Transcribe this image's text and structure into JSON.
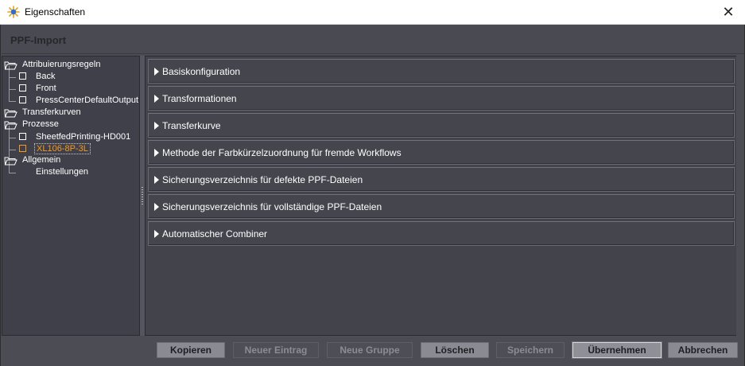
{
  "window": {
    "title": "Eigenschaften",
    "close_glyph": "✕"
  },
  "header": {
    "title": "PPF-Import"
  },
  "tree": {
    "groups": [
      {
        "label": "Attribuierungsregeln",
        "children": [
          "Back",
          "Front",
          "PressCenterDefaultOutput"
        ]
      },
      {
        "label": "Transferkurven",
        "children": []
      },
      {
        "label": "Prozesse",
        "children": [
          "SheetfedPrinting-HD001",
          "XL106-8P-3L"
        ]
      },
      {
        "label": "Allgemein",
        "children": [
          "Einstellungen"
        ]
      }
    ],
    "selected": "XL106-8P-3L",
    "selected_color": "#f59a1f"
  },
  "sections": [
    "Basiskonfiguration",
    "Transformationen",
    "Transferkurve",
    "Methode der Farbkürzelzuordnung für fremde Workflows",
    "Sicherungsverzeichnis für defekte PPF-Dateien",
    "Sicherungsverzeichnis für vollständige PPF-Dateien",
    "Automatischer Combiner"
  ],
  "buttons": {
    "kopieren": "Kopieren",
    "neuer_eintrag": "Neuer Eintrag",
    "neue_gruppe": "Neue Gruppe",
    "loeschen": "Löschen",
    "speichern": "Speichern",
    "uebernehmen": "Übernehmen",
    "abbrechen": "Abbrechen"
  },
  "colors": {
    "background": "#4c4c55",
    "panel": "#43434c",
    "accent_selected": "#f59a1f"
  }
}
